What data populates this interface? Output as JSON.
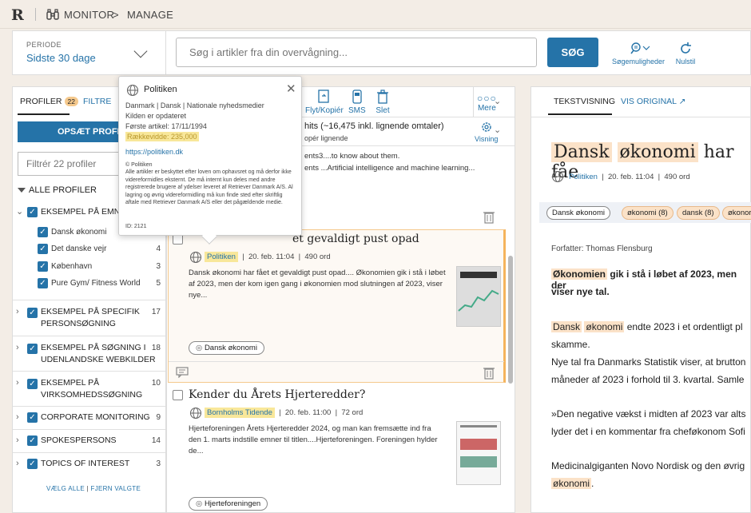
{
  "topbar": {
    "logo": "R",
    "crumb1": "MONITOR",
    "sep": ">",
    "crumb2": "MANAGE"
  },
  "filter": {
    "periode_label": "PERIODE",
    "periode_value": "Sidste 30 dage",
    "search_placeholder": "Søg i artikler fra din overvågning...",
    "search_button": "SØG",
    "options_label": "Søgemuligheder",
    "reset_label": "Nulstil"
  },
  "left": {
    "tab_profiles": "PROFILER",
    "profile_count": "22",
    "tab_filters": "FILTRE",
    "setup_button": "OPSÆT PROFIL",
    "filter_placeholder": "Filtrér 22 profiler",
    "all_profiles": "ALLE PROFILER",
    "groups": [
      {
        "label1": "EKSEMPEL PÅ EMNESØ",
        "label2": "",
        "count": ""
      },
      {
        "label1": "EKSEMPEL PÅ SPECIFIK",
        "label2": "PERSONSØGNING",
        "count": "17"
      },
      {
        "label1": "EKSEMPEL PÅ SØGNING I",
        "label2": "UDENLANDSKE WEBKILDER",
        "count": "18"
      },
      {
        "label1": "EKSEMPEL PÅ",
        "label2": "VIRKSOMHEDSSØGNING",
        "count": "10"
      },
      {
        "label1": "CORPORATE MONITORING",
        "label2": "",
        "count": "9"
      },
      {
        "label1": "SPOKESPERSONS",
        "label2": "",
        "count": "14"
      },
      {
        "label1": "TOPICS OF INTEREST",
        "label2": "",
        "count": "3"
      }
    ],
    "subprofiles": [
      {
        "label": "Dansk økonomi",
        "count": "6"
      },
      {
        "label": "Det danske vejr",
        "count": "4"
      },
      {
        "label": "København",
        "count": "3"
      },
      {
        "label": "Pure Gym/ Fitness World",
        "count": "5"
      }
    ],
    "select_all": "VÆLG ALLE",
    "divider": "|",
    "deselect": "FJERN VALGTE"
  },
  "middle": {
    "tool_move": "Flyt/Kopiér",
    "tool_sms": "SMS",
    "tool_delete": "Slet",
    "tool_more": "Mere",
    "hits_text": "hits (~16,475 inkl. lignende omtaler)",
    "hits_sub": "opér lignende",
    "view_label": "Visning",
    "prev_snippet1": "ents3....to know about them.",
    "prev_snippet2": "ents ...Artificial intelligence and machine learning...",
    "article1": {
      "title": "et gevaldigt pust opad",
      "source": "Politiken",
      "date": "20. feb. 11:04",
      "words": "490 ord",
      "snippet": "Dansk økonomi har fået et gevaldigt pust opad.... Økonomien gik i stå i løbet af 2023, men der kom igen gang i økonomien mod slutningen af 2023, viser nye...",
      "tag": "Dansk økonomi"
    },
    "article2": {
      "title": "Kender du Årets Hjerteredder?",
      "source": "Bornholms Tidende",
      "date": "20. feb. 11:00",
      "words": "72 ord",
      "snippet": "Hjerteforeningen Årets Hjerteredder 2024, og man kan fremsætte ind fra den 1. marts indstille emner til titlen....Hjerteforeningen. Foreningen hylder de...",
      "tag": "Hjerteforeningen"
    }
  },
  "right": {
    "tab_text": "TEKSTVISNING",
    "tab_original": "VIS ORIGINAL",
    "title_w1": "Dansk",
    "title_w2": "økonomi",
    "title_rest": "har fåe",
    "source": "Politiken",
    "date": "20. feb. 11:04",
    "words": "490 ord",
    "tags": [
      "Dansk økonomi",
      "økonomi (8)",
      "dansk (8)",
      "økonor"
    ],
    "author": "Forfatter: Thomas Flensburg",
    "p1_hl": "Økonomien",
    "p1_rest": "gik i stå i løbet af 2023, men der",
    "p1_line2": "viser nye tal.",
    "p2_hl1": "Dansk",
    "p2_hl2": "økonomi",
    "p2_rest": "endte 2023 i et ordentligt pl",
    "p2_line2": "skamme.",
    "p3_line1": "Nye tal fra Danmarks Statistik viser, at brutton",
    "p3_line2": "måneder af 2023 i forhold til 3. kvartal. Samle",
    "p4_line1": "»Den negative vækst i midten af 2023 var alts",
    "p4_line2": "lyder det i en kommentar fra cheføkonom Sofi",
    "p5_line1": "Medicinalgiganten Novo Nordisk og den øvrig",
    "p5_hl": "økonomi",
    "p5_end": "."
  },
  "popup": {
    "name": "Politiken",
    "line1": "Danmark | Dansk | Nationale nyhedsmedier",
    "line2": "Kilden er opdateret",
    "line3": "Første artikel: 17/11/1994",
    "line4": "Rækkevidde: 235,000",
    "link": "https://politiken.dk",
    "copy1": "© Politiken",
    "copy2": "Alle artikler er beskyttet efter loven om ophavsret og må derfor ikke videreformidles eksternt. De må internt kun deles med andre registrerede brugere af ydelser leveret af Retriever Danmark A/S. Al lagring og øvrig videreformidling må kun finde sted efter skriftlig aftale med Retriever Danmark A/S eller det pågældende medie.",
    "id": "ID: 2121"
  },
  "colors": {
    "accent": "#2573a8",
    "highlight": "#fbe2c8",
    "source_hl": "#f8e79a",
    "badge": "#f5c98d"
  }
}
